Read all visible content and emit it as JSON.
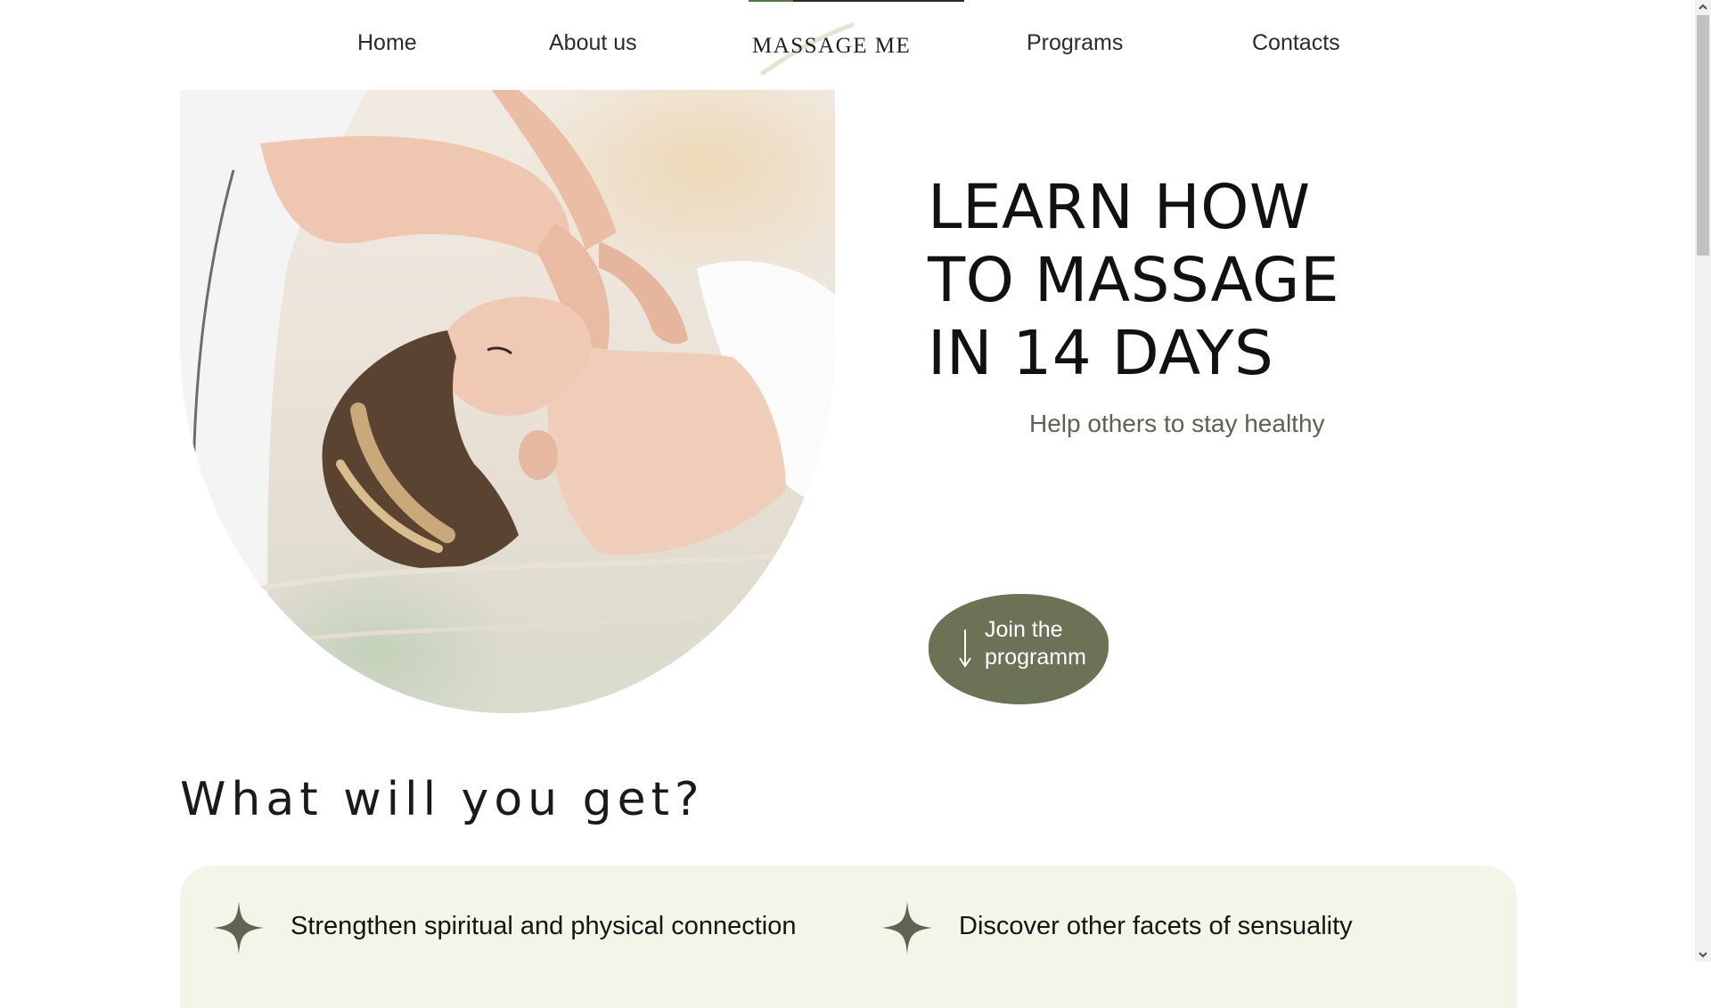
{
  "nav": {
    "home": "Home",
    "about": "About us",
    "logo": "MASSAGE ME",
    "programs": "Programs",
    "contacts": "Contacts"
  },
  "hero": {
    "image_icon": "massage-photo",
    "title_lines": [
      "LEARN HOW",
      "TO MASSAGE",
      "IN 14 DAYS"
    ],
    "subtitle": "Help others to stay healthy",
    "cta_lines": [
      "Join the",
      "programm"
    ],
    "cta_icon": "arrow-down-icon"
  },
  "section": {
    "title": "What will you get?",
    "benefits": [
      {
        "icon": "sparkle-star-icon",
        "text": "Strengthen spiritual and physical connection"
      },
      {
        "icon": "sparkle-star-icon",
        "text": "Discover other facets of sensuality"
      }
    ]
  },
  "colors": {
    "accent": "#6c7256",
    "accent_text": "#5e6150",
    "panel_bg": "#f3f5e8",
    "logo_green": "#4d7a3a"
  }
}
